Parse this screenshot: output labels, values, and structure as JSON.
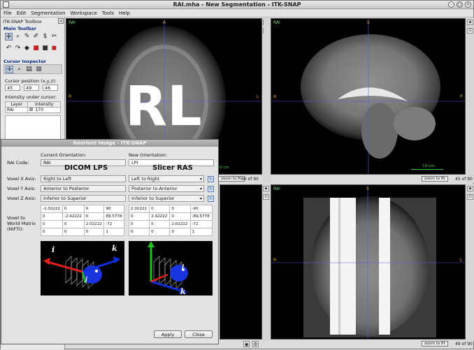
{
  "window": {
    "title": "RAI.mha - New Segmentation - ITK-SNAP"
  },
  "menu": [
    "File",
    "Edit",
    "Segmentation",
    "Workspace",
    "Tools",
    "Help"
  ],
  "toolbox": {
    "title": "ITK-SNAP Toolbox",
    "main_toolbar": "Main Toolbar",
    "cursor_inspector": "Cursor Inspector",
    "cursor_position_label": "Cursor position (x,y,z):",
    "cursor": [
      "45",
      "49",
      "46"
    ],
    "intensity_label": "Intensity under cursor:",
    "col_layer": "Layer",
    "col_intensity": "Intensity",
    "row_layer": "RAI",
    "row_intensity": "170"
  },
  "views": {
    "axial": {
      "orient": "RAI",
      "top": "A",
      "left": "R",
      "right": "L",
      "scale": "0 cm",
      "zoom": "zoom to fit",
      "slice": "46 of 90",
      "overlay_letters": "RL"
    },
    "sagittal": {
      "orient": "RAI",
      "top": "S",
      "left": "A",
      "right": "P",
      "scale": "10 cm",
      "zoom": "zoom to fit",
      "slice": "45 of 90"
    },
    "coronal": {
      "orient": "RAI",
      "top": "S",
      "left": "R",
      "right": "L",
      "zoom": "zoom to fit",
      "slice": "49 of 90"
    }
  },
  "dialog": {
    "title": "Reorient Image - ITK-SNAP",
    "rai_code_label": "RAI Code:",
    "current_label": "Current Orientation:",
    "new_label": "New Orientation:",
    "current_code": "RAI",
    "new_code": "LPI",
    "current_name": "DICOM LPS",
    "new_name": "Slicer RAS",
    "vx_label": "Voxel X Axis:",
    "vy_label": "Voxel Y Axis:",
    "vz_label": "Voxel Z Axis:",
    "cur_x": "Right to Left",
    "cur_y": "Anterior to Posterior",
    "cur_z": "Inferior to Superior",
    "new_x": "Left to Right",
    "new_y": "Posterior to Anterior",
    "new_z": "Inferior to Superior",
    "matrix_label": "Voxel to World Matrix (NIFTI):",
    "cur_matrix": [
      [
        "-2.02222",
        "0",
        "0",
        "90"
      ],
      [
        "0",
        "-2.42222",
        "0",
        "89.5778"
      ],
      [
        "0",
        "0",
        "2.02222",
        "-72"
      ],
      [
        "0",
        "0",
        "0",
        "1"
      ]
    ],
    "new_matrix": [
      [
        "2.02222",
        "0",
        "0",
        "-90"
      ],
      [
        "0",
        "2.42222",
        "0",
        "-89.5778"
      ],
      [
        "0",
        "0",
        "2.02222",
        "-72"
      ],
      [
        "0",
        "0",
        "0",
        "1"
      ]
    ],
    "apply": "Apply",
    "close": "Close",
    "axis_i": "i",
    "axis_j": "j",
    "axis_k": "k"
  },
  "colors": {
    "dialog_title": "#9a9a9a",
    "orient_label": "#e0a020",
    "scale": "#3ec83e",
    "axis_red": "#e02020",
    "axis_green": "#20c020",
    "axis_blue": "#1030e0"
  }
}
